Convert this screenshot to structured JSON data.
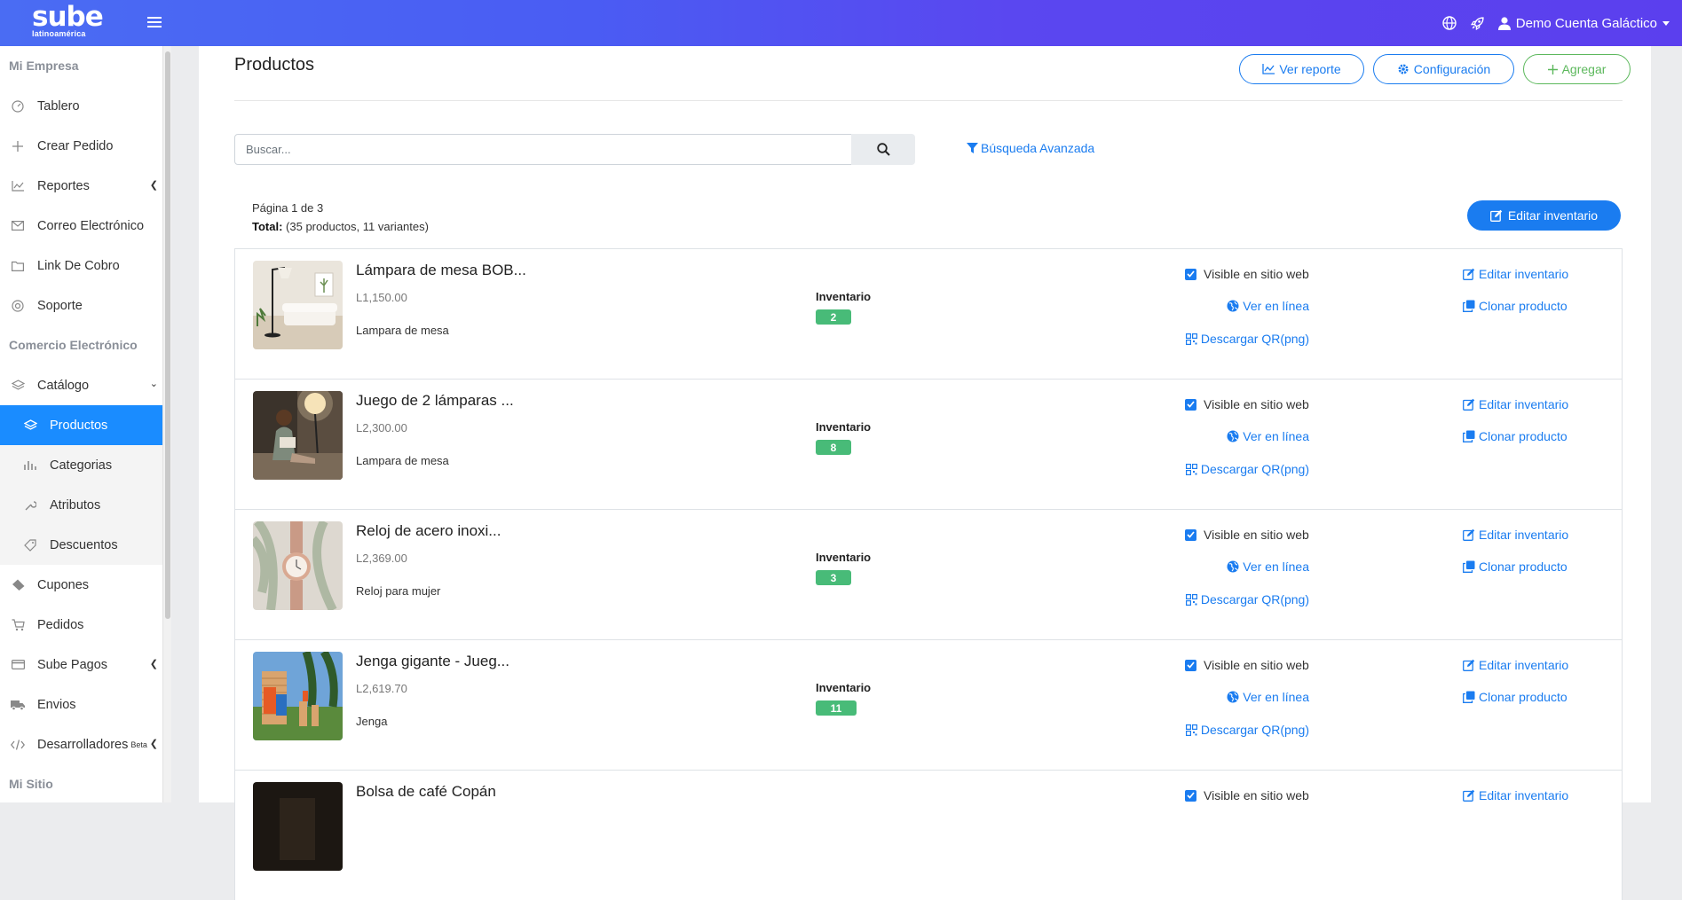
{
  "header": {
    "logo_main": "sube",
    "logo_sub": "latinoamérica",
    "user_label": "Demo Cuenta Galáctico"
  },
  "sidebar": {
    "section_empresa": "Mi Empresa",
    "section_comercio": "Comercio Electrónico",
    "section_sitio": "Mi Sitio",
    "items": {
      "tablero": "Tablero",
      "crear_pedido": "Crear Pedido",
      "reportes": "Reportes",
      "correo": "Correo Electrónico",
      "link_cobro": "Link De Cobro",
      "soporte": "Soporte",
      "catalogo": "Catálogo",
      "productos": "Productos",
      "categorias": "Categorias",
      "atributos": "Atributos",
      "descuentos": "Descuentos",
      "cupones": "Cupones",
      "pedidos": "Pedidos",
      "sube_pagos": "Sube Pagos",
      "envios": "Envios",
      "desarrolladores": "Desarrolladores",
      "beta": "Beta"
    }
  },
  "page": {
    "title": "Productos",
    "btn_report": "Ver reporte",
    "btn_config": "Configuración",
    "btn_add": "Agregar",
    "search_placeholder": "Buscar...",
    "advanced_search": "Búsqueda Avanzada",
    "page_label": "Página 1 de 3",
    "total_label": "Total:",
    "total_value": "(35 productos, 11 variantes)",
    "btn_edit_inventory": "Editar inventario"
  },
  "row_labels": {
    "inventory": "Inventario",
    "visible": "Visible en sitio web",
    "online": "Ver en línea",
    "qr": "Descargar QR(png)",
    "edit": "Editar inventario",
    "clone": "Clonar producto"
  },
  "products": [
    {
      "name": "Lámpara de mesa BOB...",
      "price": "L1,150.00",
      "category": "Lampara de mesa",
      "inventory": "2"
    },
    {
      "name": "Juego de 2 lámparas ...",
      "price": "L2,300.00",
      "category": "Lampara de mesa",
      "inventory": "8"
    },
    {
      "name": "Reloj de acero inoxi...",
      "price": "L2,369.00",
      "category": "Reloj para mujer",
      "inventory": "3"
    },
    {
      "name": "Jenga gigante - Jueg...",
      "price": "L2,619.70",
      "category": "Jenga",
      "inventory": "11"
    },
    {
      "name": "Bolsa de café Copán",
      "price": "",
      "category": "",
      "inventory": ""
    }
  ]
}
